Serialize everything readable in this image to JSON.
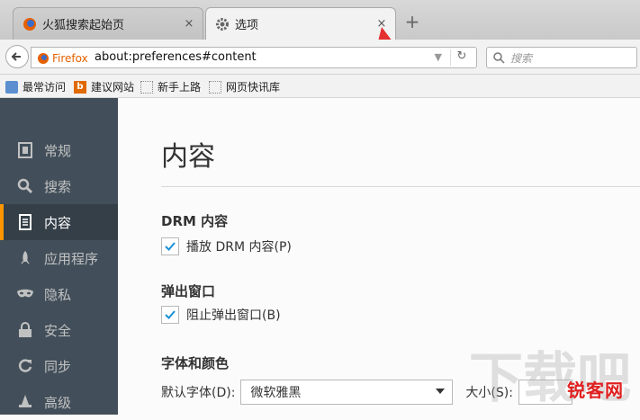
{
  "tabs": [
    {
      "title": "火狐搜索起始页",
      "close": "×"
    },
    {
      "title": "选项",
      "close": "×"
    }
  ],
  "new_tab_symbol": "+",
  "navbar": {
    "identity_label": "Firefox",
    "url": "about:preferences#content",
    "search_placeholder": "搜索"
  },
  "bookmarks": [
    "最常访问",
    "建议网站",
    "新手上路",
    "网页快讯库"
  ],
  "sidebar": {
    "items": [
      {
        "label": "常规",
        "icon": "general-icon"
      },
      {
        "label": "搜索",
        "icon": "search-icon"
      },
      {
        "label": "内容",
        "icon": "content-icon",
        "selected": true
      },
      {
        "label": "应用程序",
        "icon": "rocket-icon"
      },
      {
        "label": "隐私",
        "icon": "mask-icon"
      },
      {
        "label": "安全",
        "icon": "lock-icon"
      },
      {
        "label": "同步",
        "icon": "sync-icon"
      },
      {
        "label": "高级",
        "icon": "wizard-icon"
      }
    ]
  },
  "main": {
    "title": "内容",
    "drm": {
      "heading": "DRM 内容",
      "checkbox_label": "播放 DRM 内容(P)",
      "checked": true
    },
    "popups": {
      "heading": "弹出窗口",
      "checkbox_label": "阻止弹出窗口(B)",
      "checked": true
    },
    "fonts": {
      "heading": "字体和颜色",
      "default_font_label": "默认字体(D):",
      "default_font_value": "微软雅黑",
      "size_label": "大小(S):"
    }
  },
  "watermark": "锐客网",
  "colors": {
    "sidebar_bg": "#424f5a",
    "accent": "#ff9500",
    "check": "#1a8fd8"
  }
}
